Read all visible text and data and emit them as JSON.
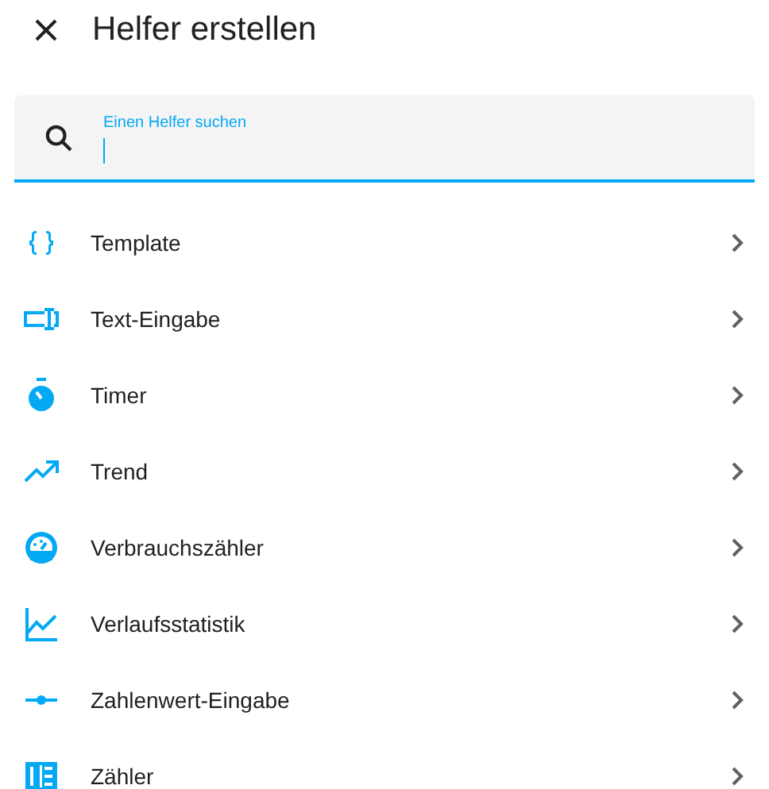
{
  "dialog": {
    "title": "Helfer erstellen"
  },
  "search": {
    "label": "Einen Helfer suchen",
    "focused": true
  },
  "items": [
    {
      "kind": "template",
      "label": "Template"
    },
    {
      "kind": "text",
      "label": "Text-Eingabe"
    },
    {
      "kind": "timer",
      "label": "Timer"
    },
    {
      "kind": "trend",
      "label": "Trend"
    },
    {
      "kind": "meter",
      "label": "Verbrauchszähler"
    },
    {
      "kind": "statistics",
      "label": "Verlaufsstatistik"
    },
    {
      "kind": "number",
      "label": "Zahlenwert-Eingabe"
    },
    {
      "kind": "counter",
      "label": "Zähler"
    }
  ]
}
